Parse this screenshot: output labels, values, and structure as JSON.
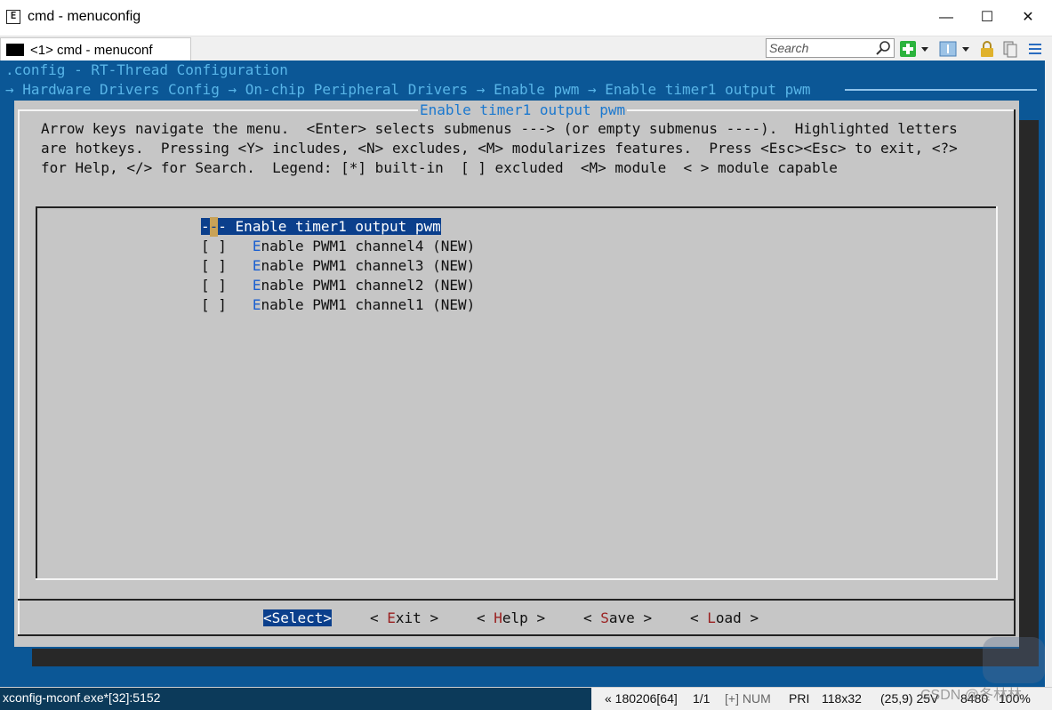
{
  "window": {
    "title": "cmd - menuconfig",
    "icon": "console-app-icon",
    "minimize": "—",
    "maximize": "☐",
    "close": "✕"
  },
  "toolbar": {
    "tab_label": "<1>  cmd - menuconf",
    "search_placeholder": "Search",
    "icons": [
      "search-icon",
      "new-console-icon",
      "dropdown-icon",
      "view-icon",
      "dropdown-icon",
      "lock-icon",
      "copy-icon",
      "menu-icon"
    ],
    "accent_green": "#2bb33d"
  },
  "console": {
    "header": ".config - RT-Thread Configuration",
    "breadcrumb": "→ Hardware Drivers Config → On-chip Peripheral Drivers → Enable pwm → Enable timer1 output pwm",
    "background": "#0b5796"
  },
  "dialog": {
    "title": "Enable timer1 output pwm",
    "help_lines": [
      "Arrow keys navigate the menu.  <Enter> selects submenus ---> (or empty submenus ----).  Highlighted letters",
      "are hotkeys.  Pressing <Y> includes, <N> excludes, <M> modularizes features.  Press <Esc><Esc> to exit, <?>",
      "for Help, </> for Search.  Legend: [*] built-in  [ ] excluded  <M> module  < > module capable"
    ],
    "menu": {
      "selected": {
        "prefix_a": "-",
        "prefix_b": "-",
        "prefix_c": "- ",
        "label": "Enable timer1 output pwm"
      },
      "items": [
        {
          "box": "[ ]",
          "hot": "E",
          "rest": "nable PWM1 channel4 (NEW)"
        },
        {
          "box": "[ ]",
          "hot": "E",
          "rest": "nable PWM1 channel3 (NEW)"
        },
        {
          "box": "[ ]",
          "hot": "E",
          "rest": "nable PWM1 channel2 (NEW)"
        },
        {
          "box": "[ ]",
          "hot": "E",
          "rest": "nable PWM1 channel1 (NEW)"
        }
      ]
    },
    "buttons": {
      "select": "<Select>",
      "exit": {
        "pre": "< ",
        "hot": "E",
        "rest": "xit >"
      },
      "help": {
        "pre": "< ",
        "hot": "H",
        "rest": "elp >"
      },
      "save": {
        "pre": "< ",
        "hot": "S",
        "rest": "ave >"
      },
      "load": {
        "pre": "< ",
        "hot": "L",
        "rest": "oad >"
      }
    }
  },
  "status": {
    "process": "xconfig-mconf.exe*[32]:5152",
    "info": "« 180206[64]",
    "pages": "1/1",
    "num": "[+] NUM",
    "pri": "PRI",
    "size": "118x32",
    "cursor": "(25,9) 25V",
    "pid": "8480",
    "zoom": "100%",
    "watermark": "CSDN @冬林林"
  }
}
